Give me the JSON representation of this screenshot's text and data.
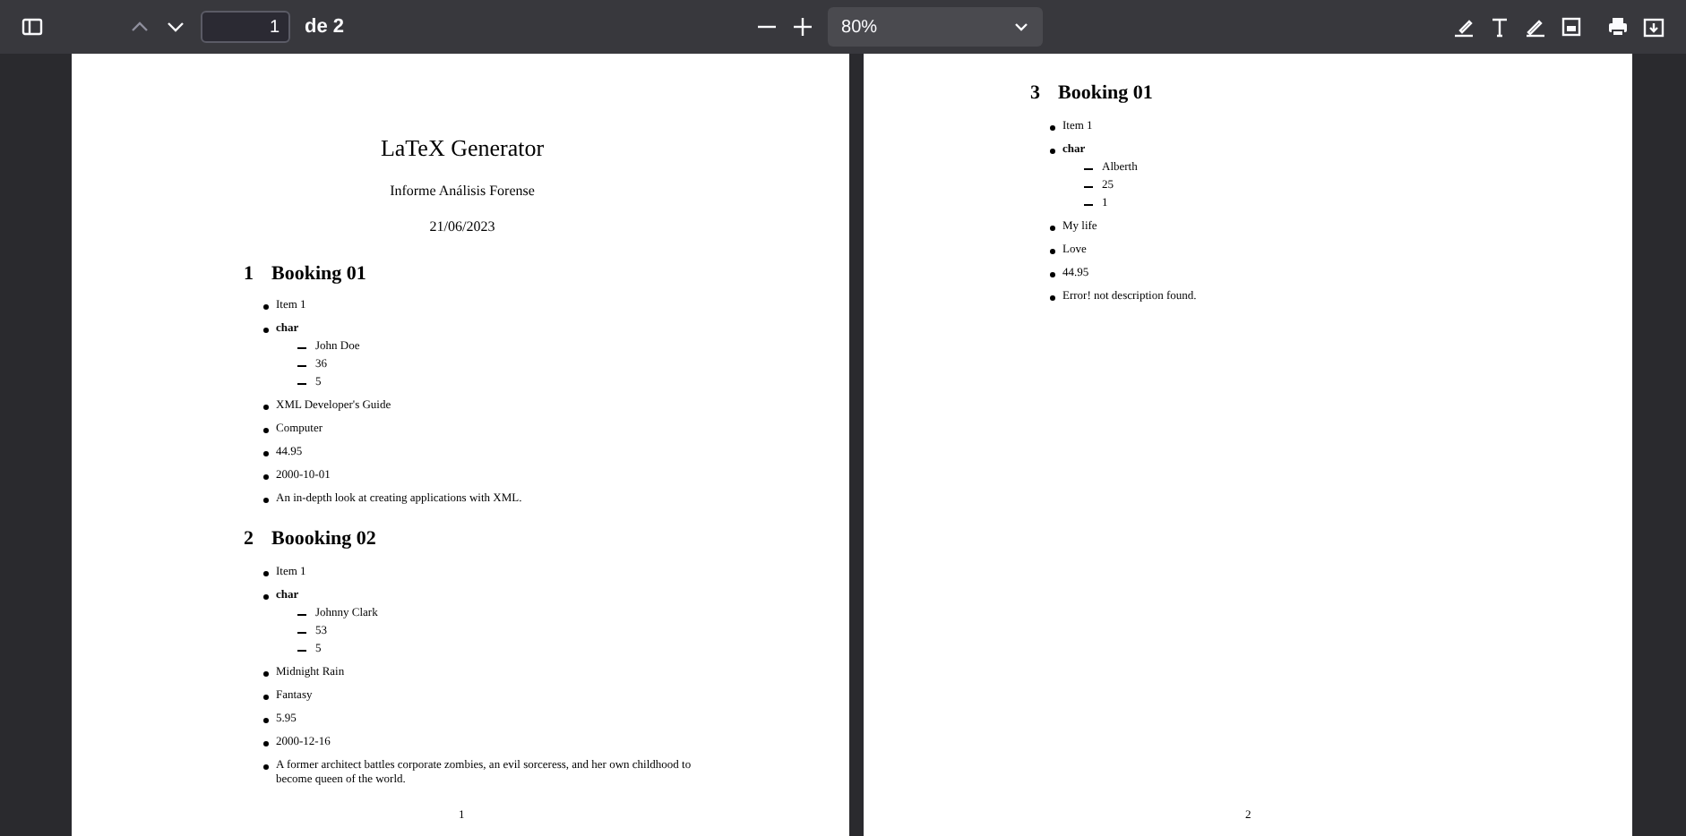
{
  "toolbar": {
    "page_input": "1",
    "page_total": "de 2",
    "zoom": "80%"
  },
  "pages": [
    {
      "header": {
        "title": "LaTeX Generator",
        "subtitle": "Informe Análisis Forense",
        "date": "21/06/2023"
      },
      "sections": [
        {
          "number": "1",
          "title": "Booking 01",
          "items": [
            {
              "text": "Item 1",
              "bold": false
            },
            {
              "text": "char",
              "bold": true,
              "children": [
                {
                  "text": "John Doe"
                },
                {
                  "text": "36"
                },
                {
                  "text": "5"
                }
              ]
            },
            {
              "text": "XML Developer's Guide",
              "bold": false
            },
            {
              "text": "Computer",
              "bold": false
            },
            {
              "text": "44.95",
              "bold": false
            },
            {
              "text": "2000-10-01",
              "bold": false
            },
            {
              "text": "An in-depth look at creating applications with XML.",
              "bold": false
            }
          ]
        },
        {
          "number": "2",
          "title": "Boooking 02",
          "items": [
            {
              "text": "Item 1",
              "bold": false
            },
            {
              "text": "char",
              "bold": true,
              "children": [
                {
                  "text": "Johnny Clark"
                },
                {
                  "text": "53"
                },
                {
                  "text": "5"
                }
              ]
            },
            {
              "text": "Midnight Rain",
              "bold": false
            },
            {
              "text": "Fantasy",
              "bold": false
            },
            {
              "text": "5.95",
              "bold": false
            },
            {
              "text": "2000-12-16",
              "bold": false
            },
            {
              "text": "A former architect battles corporate zombies, an evil sorceress, and her own childhood to become queen of the world.",
              "bold": false
            }
          ]
        }
      ],
      "page_number": "1"
    },
    {
      "sections": [
        {
          "number": "3",
          "title": "Booking 01",
          "items": [
            {
              "text": "Item 1",
              "bold": false
            },
            {
              "text": "char",
              "bold": true,
              "children": [
                {
                  "text": "Alberth"
                },
                {
                  "text": "25"
                },
                {
                  "text": "1"
                }
              ]
            },
            {
              "text": "My life",
              "bold": false
            },
            {
              "text": "Love",
              "bold": false
            },
            {
              "text": "44.95",
              "bold": false
            },
            {
              "text": "Error! not description found.",
              "bold": false
            }
          ]
        }
      ],
      "page_number": "2"
    }
  ]
}
